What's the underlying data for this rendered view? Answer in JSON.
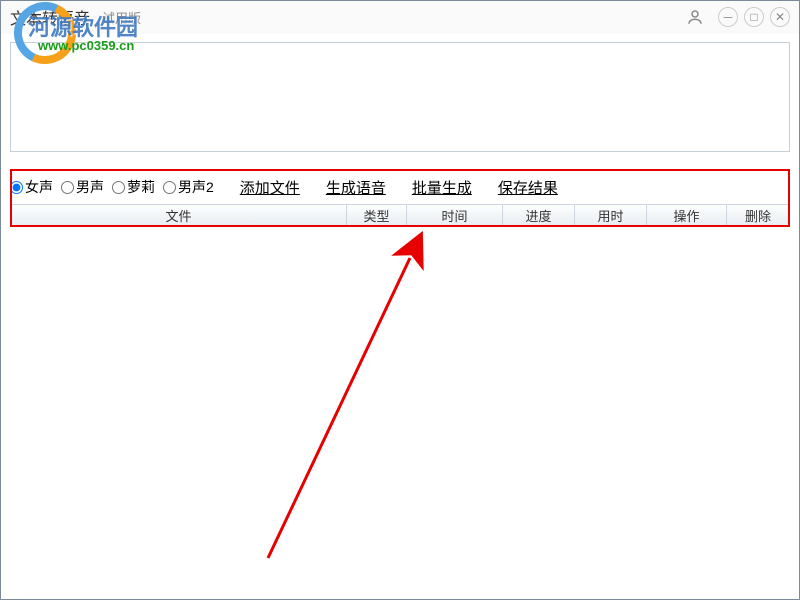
{
  "titlebar": {
    "title": "文本转语音",
    "subtitle": "试用版"
  },
  "watermark": {
    "site_name": "河源软件园",
    "url": "www.pc0359.cn"
  },
  "voice_options": {
    "opt1": "女声",
    "opt2": "男声",
    "opt3": "萝莉",
    "opt4": "男声2",
    "selected": "女声"
  },
  "actions": {
    "add_file": "添加文件",
    "gen_audio": "生成语音",
    "batch_gen": "批量生成",
    "save_result": "保存结果"
  },
  "columns": {
    "file": "文件",
    "type": "类型",
    "time": "时间",
    "progress": "进度",
    "duration": "用时",
    "operate": "操作",
    "delete": "删除"
  },
  "annotation": {
    "highlight_color": "#e60000",
    "arrow_color": "#e60000"
  }
}
